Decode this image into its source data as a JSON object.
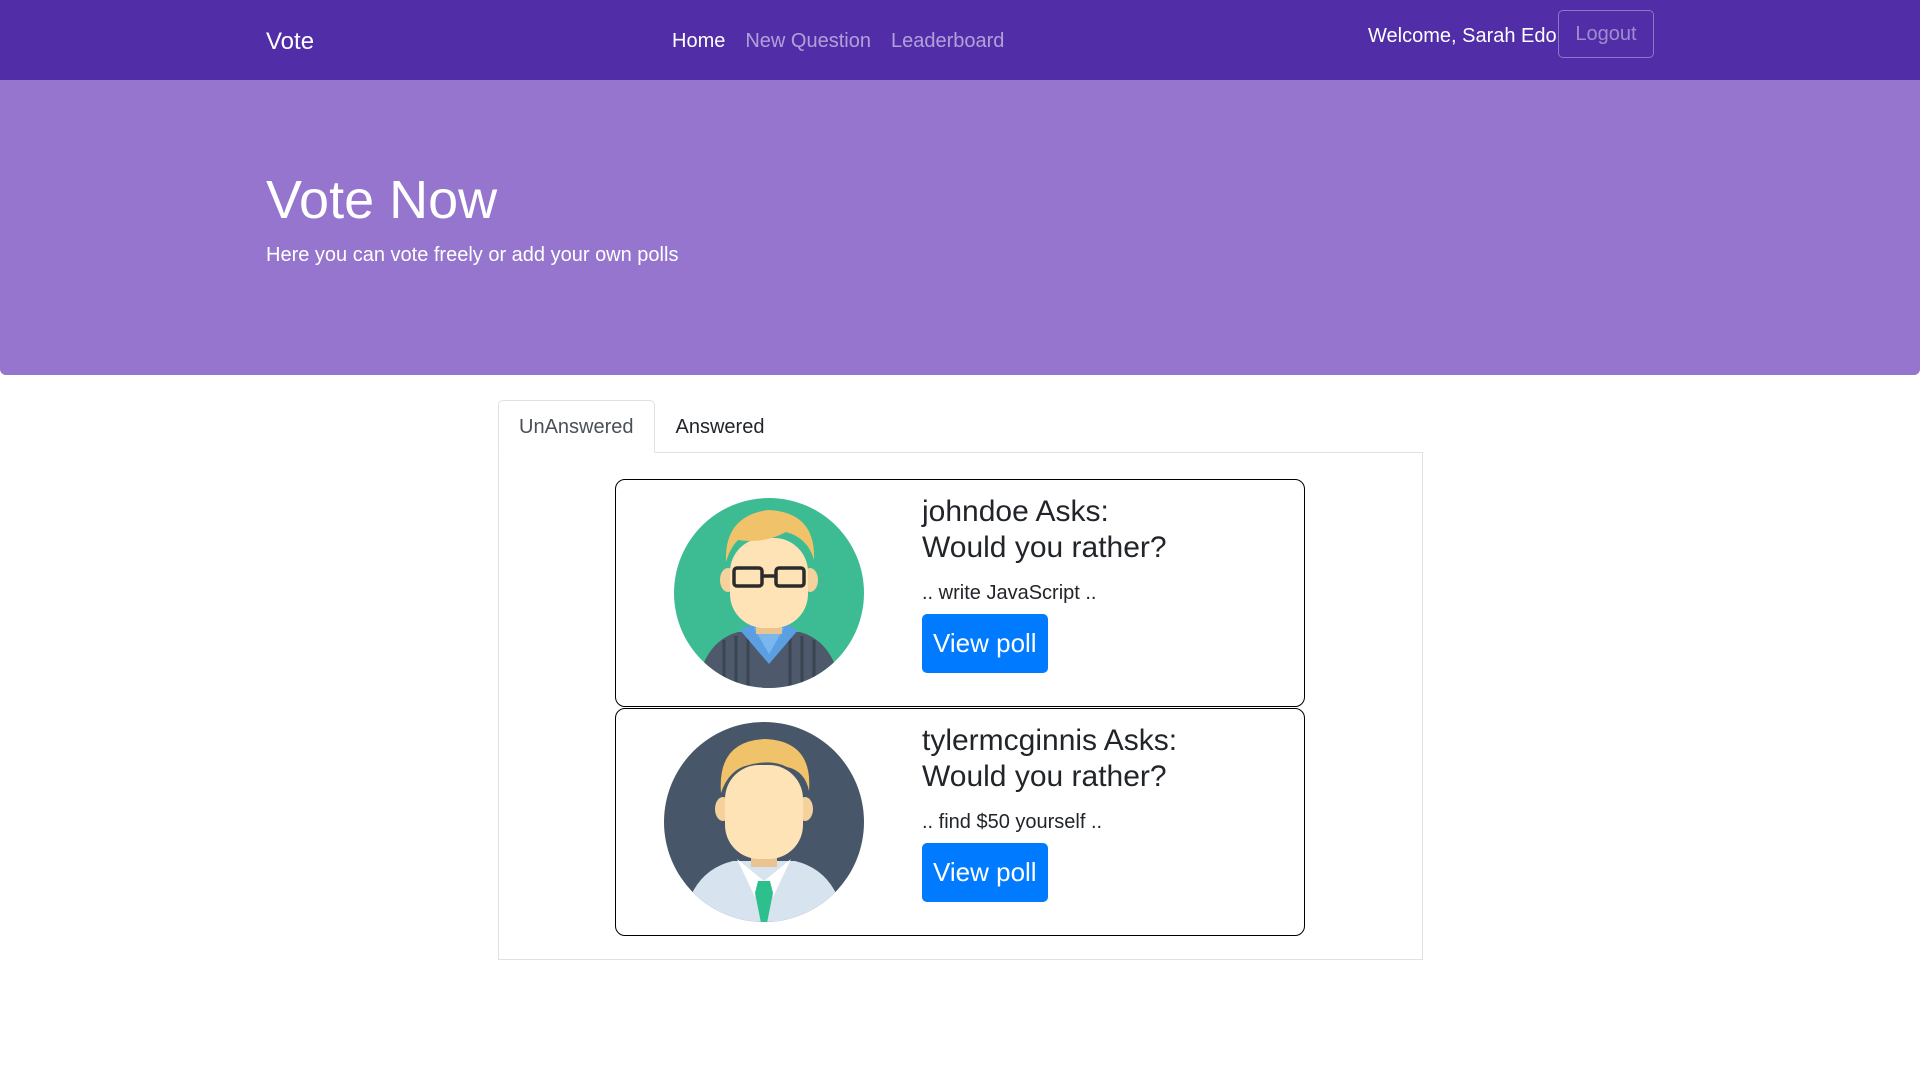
{
  "navbar": {
    "brand": "Vote",
    "links": [
      {
        "label": "Home",
        "active": true
      },
      {
        "label": "New Question",
        "active": false
      },
      {
        "label": "Leaderboard",
        "active": false
      }
    ],
    "welcome": "Welcome, Sarah Edo",
    "logout_label": "Logout"
  },
  "hero": {
    "title": "Vote Now",
    "subtitle": "Here you can vote freely or add your own polls"
  },
  "tabs": [
    {
      "label": "UnAnswered",
      "active": true
    },
    {
      "label": "Answered",
      "active": false
    }
  ],
  "polls": [
    {
      "asker": "johndoe Asks:",
      "question": "Would you rather?",
      "teaser": ".. write JavaScript ..",
      "button": "View poll",
      "avatar": "man-with-glasses-avatar"
    },
    {
      "asker": "tylermcginnis Asks:",
      "question": "Would you rather?",
      "teaser": ".. find $50 yourself ..",
      "button": "View poll",
      "avatar": "man-with-tie-avatar"
    }
  ],
  "colors": {
    "navbar": "#512da8",
    "hero": "#9575cd",
    "primary_button": "#007bff"
  }
}
